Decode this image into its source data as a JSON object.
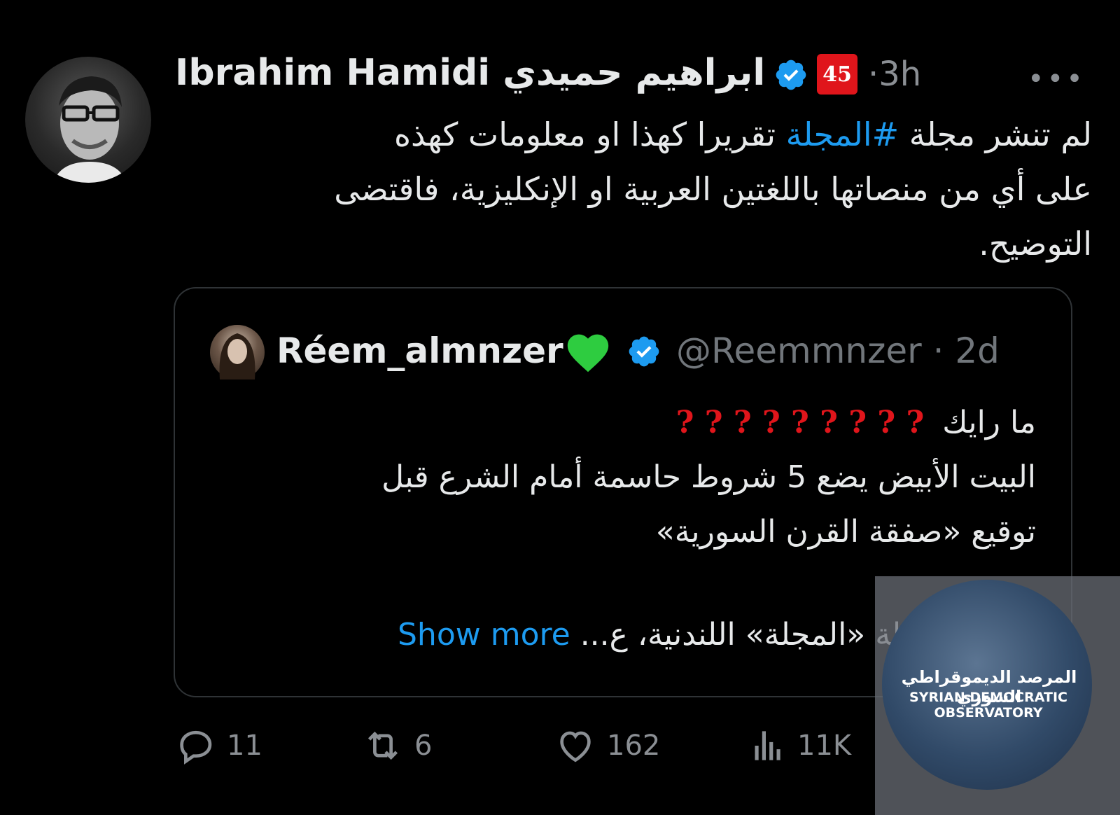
{
  "tweet": {
    "display_name": "Ibrahim Hamidi ابراهيم حميدي",
    "time": "·3h",
    "flair": "45",
    "text_line1_before": "لم تنشر مجلة ",
    "hashtag": "#المجلة",
    "text_line1_after": " تقريرا كهذا او معلومات كهذه",
    "text_line2": "على أي من منصاتها باللغتين العربية او الإنكليزية، فاقتضى",
    "text_line3": "التوضيح."
  },
  "quote": {
    "display_name": "Réem_almnzer",
    "handle_time": "@Reemmnzer · 2d",
    "line1": "ما رايك",
    "question_marks": "? ? ? ? ? ? ? ? ?",
    "line2": "البيت الأبيض يضع 5 شروط حاسمة أمام الشرع قبل",
    "line3": "توقيع «صفقة القرن السورية»",
    "truncated": "كشفت مجلة «المجلة» اللندنية، ع...",
    "show_more": "Show more"
  },
  "actions": {
    "replies": "11",
    "reposts": "6",
    "likes": "162",
    "views": "11K"
  },
  "watermark": {
    "arabic": "المرصد الديموقراطي السوري",
    "english": "SYRIAN DEMOCRATIC OBSERVATORY"
  },
  "colors": {
    "accent": "#1d9bf0",
    "muted": "#8b8f94",
    "background": "#000000",
    "flair": "#e0151b",
    "heart": "#2ecc40"
  }
}
